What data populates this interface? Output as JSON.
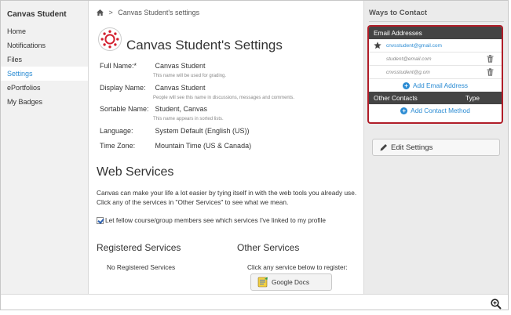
{
  "leftnav": {
    "title": "Canvas Student",
    "items": [
      {
        "label": "Home",
        "active": false
      },
      {
        "label": "Notifications",
        "active": false
      },
      {
        "label": "Files",
        "active": false
      },
      {
        "label": "Settings",
        "active": true
      },
      {
        "label": "ePortfolios",
        "active": false
      },
      {
        "label": "My Badges",
        "active": false
      }
    ]
  },
  "breadcrumb": {
    "separator": ">",
    "current": "Canvas Student's settings"
  },
  "profile": {
    "page_title": "Canvas Student's Settings",
    "full_name": {
      "label": "Full Name:*",
      "value": "Canvas Student",
      "help": "This name will be used for grading."
    },
    "display_name": {
      "label": "Display Name:",
      "value": "Canvas Student",
      "help": "People will see this name in discussions, messages and comments."
    },
    "sortable_name": {
      "label": "Sortable Name:",
      "value": "Student, Canvas",
      "help": "This name appears in sorted lists."
    },
    "language": {
      "label": "Language:",
      "value": "System Default (English (US))"
    },
    "time_zone": {
      "label": "Time Zone:",
      "value": "Mountain Time (US & Canada)"
    }
  },
  "web_services": {
    "heading": "Web Services",
    "description": "Canvas can make your life a lot easier by tying itself in with the web tools you already use. Click any of the services in \"Other Services\" to see what we mean.",
    "checkbox_label": "Let fellow course/group members see which services I've linked to my profile",
    "checkbox_checked": true,
    "registered_heading": "Registered Services",
    "registered_empty": "No Registered Services",
    "other_heading": "Other Services",
    "other_hint": "Click any service below to register:",
    "google_docs_label": "Google Docs"
  },
  "ways_to_contact": {
    "title": "Ways to Contact",
    "email_header": "Email Addresses",
    "emails": [
      {
        "address": "cnvsstudent@gmail.com",
        "primary": true
      },
      {
        "address": "student@email.com",
        "primary": false
      },
      {
        "address": "cnvsstudent@g.om",
        "primary": false
      }
    ],
    "add_email_label": "Add Email Address",
    "other_contacts_header": "Other Contacts",
    "type_header": "Type",
    "add_contact_label": "Add Contact Method"
  },
  "edit_settings_label": "Edit Settings",
  "colors": {
    "accent": "#2a8bd3",
    "highlight_border": "#b01d28",
    "header_dark": "#444444",
    "canvas_red": "#d3202f"
  },
  "icons": {
    "home": "home-icon",
    "star": "star-icon",
    "trash": "trash-icon",
    "plus": "plus-circle-icon",
    "pencil": "pencil-icon",
    "zoom": "zoom-in-icon",
    "avatar": "canvas-logo-icon",
    "google_docs": "google-docs-icon"
  }
}
